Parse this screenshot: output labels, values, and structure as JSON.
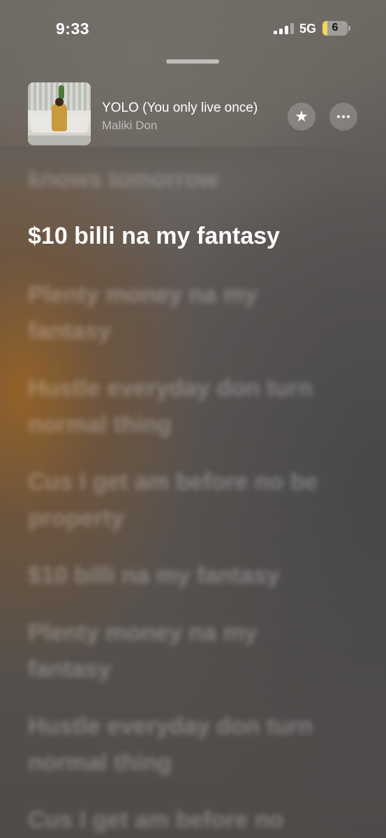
{
  "status_bar": {
    "time": "9:33",
    "network": "5G",
    "battery_level": "6",
    "signal_bars_active": 3,
    "battery_color": "#f3d75a"
  },
  "now_playing": {
    "title": "YOLO (You only live once)",
    "artist": "Maliki Don",
    "favorite_icon": "star-icon",
    "more_icon": "ellipsis-icon"
  },
  "lyrics": {
    "previous": "knows tomorrow",
    "active": "$10 billi na my fantasy",
    "upcoming": [
      "Plenty money na my fantasy",
      "Hustle everyday don turn normal thing",
      "Cus I get am before no be property",
      "$10 billi na my fantasy",
      "Plenty money na my fantasy",
      "Hustle everyday don turn normal thing",
      "Cus I get am before no"
    ]
  }
}
